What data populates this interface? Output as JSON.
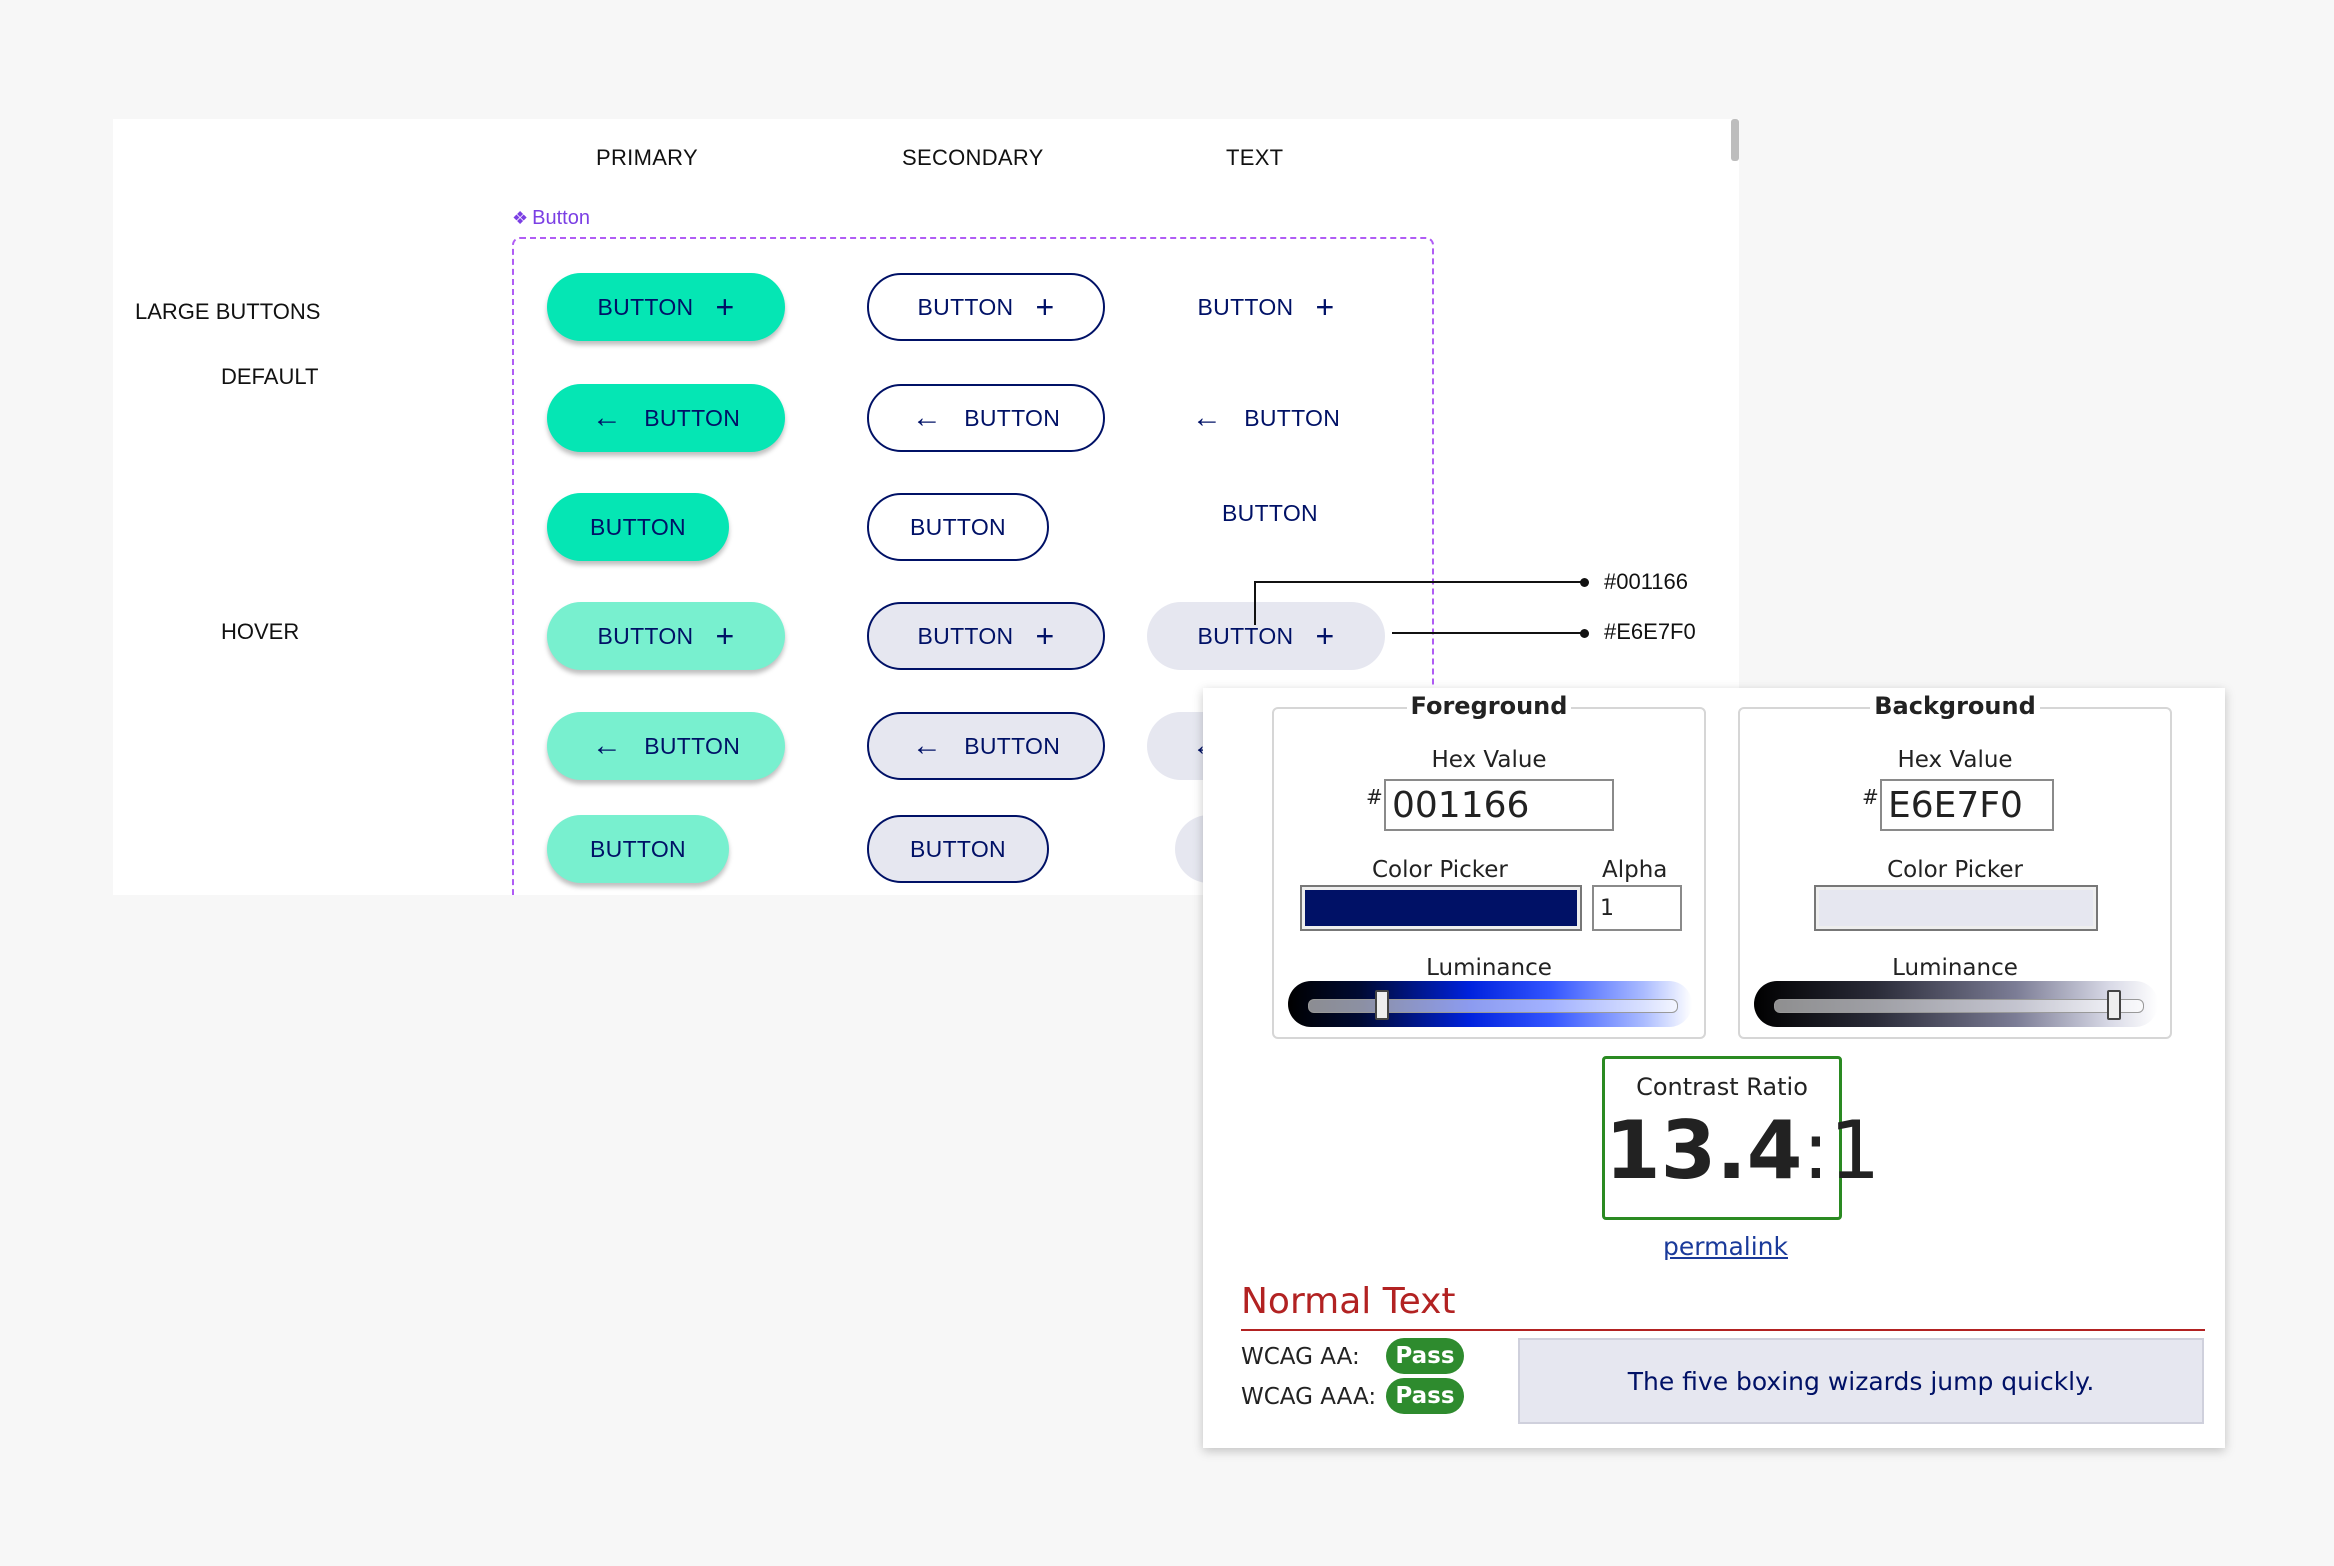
{
  "columns": {
    "primary": "PRIMARY",
    "secondary": "SECONDARY",
    "text": "TEXT"
  },
  "rows": {
    "large_buttons": "LARGE BUTTONS",
    "default": "DEFAULT",
    "hover": "HOVER"
  },
  "component": {
    "name": "Button",
    "frame_color": "#b05cf5"
  },
  "button_label": "BUTTON",
  "colors": {
    "primary_default": "#05e6b4",
    "primary_hover": "#78f0cf",
    "text_color": "#001166",
    "hover_bg": "#E6E7F0"
  },
  "annotations": {
    "foreground": "#001166",
    "background": "#E6E7F0"
  },
  "contrast_checker": {
    "foreground": {
      "legend": "Foreground",
      "hex_label": "Hex Value",
      "hash": "#",
      "hex_value": "001166",
      "color_picker_label": "Color Picker",
      "alpha_label": "Alpha",
      "alpha_value": "1",
      "luminance_label": "Luminance",
      "luminance_fraction": 0.2
    },
    "background": {
      "legend": "Background",
      "hex_label": "Hex Value",
      "hash": "#",
      "hex_value": "E6E7F0",
      "color_picker_label": "Color Picker",
      "luminance_label": "Luminance",
      "luminance_fraction": 0.92
    },
    "ratio_label": "Contrast Ratio",
    "ratio_main": "13.4",
    "ratio_suffix": ":1",
    "permalink": "permalink",
    "normal_text": {
      "heading": "Normal Text",
      "aa_label": "WCAG AA:",
      "aa_result": "Pass",
      "aaa_label": "WCAG AAA:",
      "aaa_result": "Pass",
      "sample_text": "The five boxing wizards jump quickly."
    }
  }
}
